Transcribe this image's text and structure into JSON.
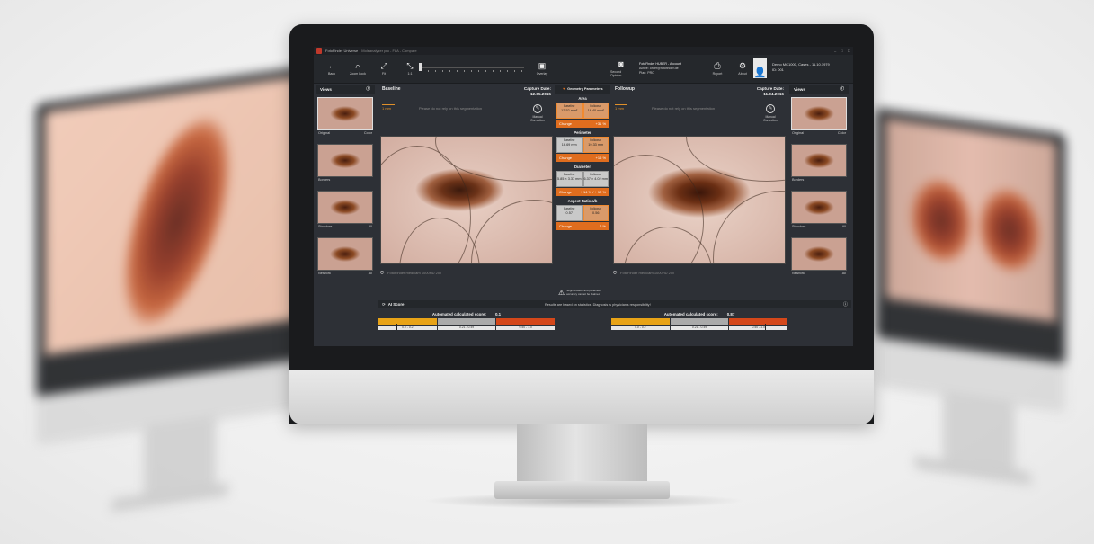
{
  "titlebar": {
    "app": "FotoFinder Universe",
    "module": "Moleanalyzer pro - FLA - Compare"
  },
  "toolbar": {
    "back": "Back",
    "zoom": "Zoom Lock",
    "fit": "Fit",
    "one_to_one": "1:1",
    "overlay": "Overlay",
    "second_opinion": "Second Opinion",
    "report": "Report",
    "about": "About"
  },
  "account": {
    "line1": "FotoFinder HUBER - Account",
    "line2": "Active: order@fotofinder.de",
    "line3": "Plan: PRO"
  },
  "patient": {
    "name": "Demo MC1000, Cases - 11.10.1979",
    "id": "ID: 001"
  },
  "views": {
    "title": "Views",
    "items": [
      {
        "label": "Original",
        "mode": "Color"
      },
      {
        "label": "Borders",
        "mode": ""
      },
      {
        "label": "Structure",
        "mode": "All"
      },
      {
        "label": "Network",
        "mode": "All"
      }
    ]
  },
  "baseline": {
    "title": "Baseline",
    "capture_label": "Capture Date:",
    "capture_date": "12.05.2015",
    "scale": "1 mm",
    "warning": "Please do not rely on this segmentation",
    "manual": "Manual Correction",
    "device": "FotoFinder medicam 1000HD 20x"
  },
  "followup": {
    "title": "Followup",
    "capture_label": "Capture Date:",
    "capture_date": "11.04.2016",
    "scale": "1 mm",
    "warning": "Please do not rely on this segmentation",
    "manual": "Manual Correction",
    "device": "FotoFinder medicam 1000HD 20x"
  },
  "geometry": {
    "title": "Geometry Parameters",
    "metrics": [
      {
        "name": "Area",
        "base_label": "Baseline",
        "base_value": "12.52 mm²",
        "follow_label": "Followup",
        "follow_value": "16.40 mm²",
        "change_label": "Change",
        "change": "+31 %"
      },
      {
        "name": "Perimeter",
        "base_label": "Baseline",
        "base_value": "16.69 mm",
        "follow_label": "Followup",
        "follow_value": "19.33 mm",
        "change_label": "Change",
        "change": "+16 %"
      },
      {
        "name": "Diameter",
        "base_label": "Baseline",
        "base_value": "5.85 × 3.37 mm",
        "follow_label": "Followup",
        "follow_value": "6.37 × 4.02 mm",
        "change_label": "Change",
        "change": "+ 14 % / + 12 %"
      },
      {
        "name": "Aspect Ratio a/b",
        "base_label": "Baseline",
        "base_value": "0.57",
        "follow_label": "Followup",
        "follow_value": "0.56",
        "change_label": "Change",
        "change": "-2 %"
      }
    ],
    "note": "Segmentation and parameter accuracy cannot be claimed."
  },
  "ai": {
    "title": "AI Score",
    "note": "Results are based on statistics. Diagnosis is physician's responsibility!",
    "baseline": {
      "label": "Automated calculated score:",
      "score": "0.1",
      "score_fraction": 0.1
    },
    "followup": {
      "label": "Automated calculated score:",
      "score": "0.87",
      "score_fraction": 0.87
    },
    "ranges": [
      "0.0 - 0.2",
      "0.21 - 0.49",
      "0.50 - 1.0"
    ]
  }
}
